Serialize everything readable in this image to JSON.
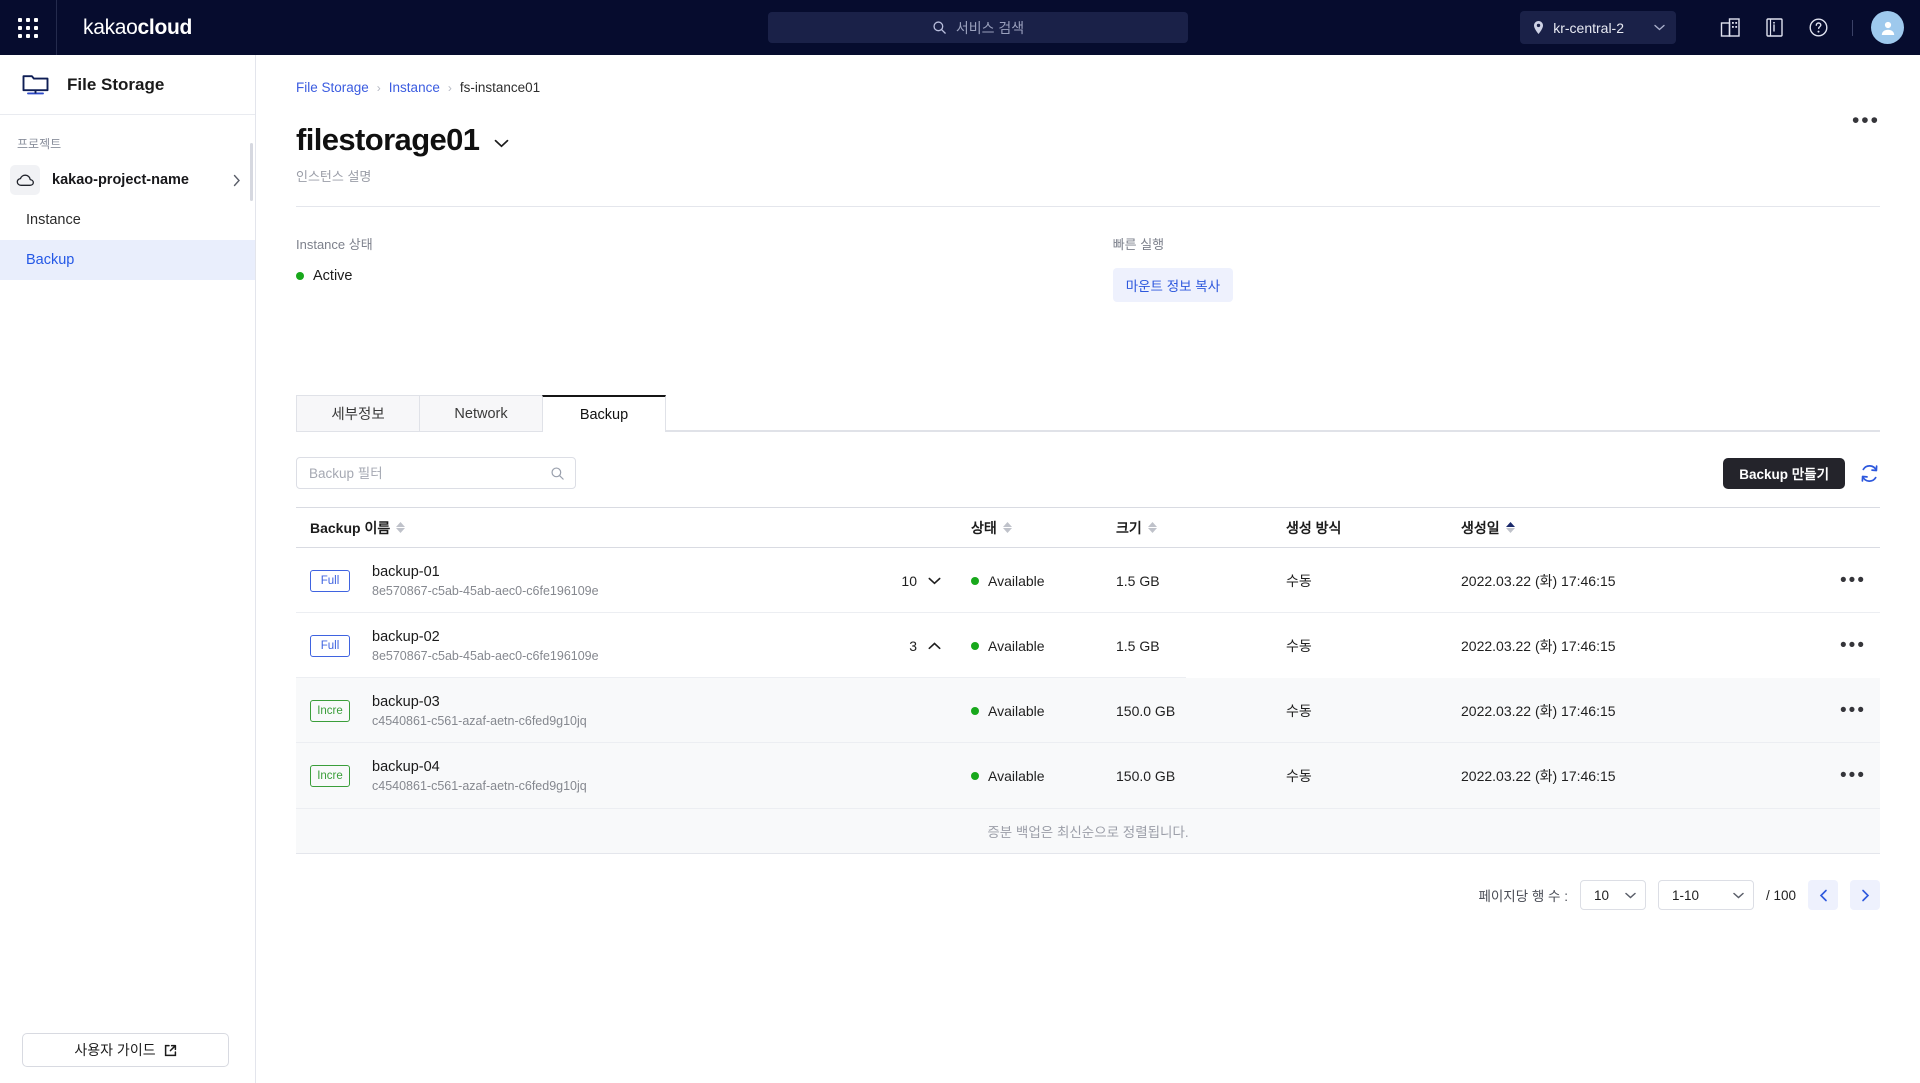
{
  "topbar": {
    "apps_icon": "apps-grid-icon",
    "brand_light": "kakao",
    "brand_bold": "cloud",
    "search_placeholder": "서비스 검색",
    "search_icon": "search-icon",
    "region": "kr-central-2",
    "region_icon": "location-pin-icon",
    "icons": [
      "organization-icon",
      "documentation-icon",
      "help-icon"
    ],
    "avatar_icon": "user-avatar-icon"
  },
  "sidebar": {
    "service_title": "File Storage",
    "service_icon": "monitor-icon",
    "section_label": "프로젝트",
    "project_name": "kakao-project-name",
    "project_icon": "cloud-icon",
    "items": [
      {
        "label": "Instance",
        "active": false
      },
      {
        "label": "Backup",
        "active": true
      }
    ],
    "guide_button": "사용자 가이드",
    "guide_icon": "external-link-icon"
  },
  "breadcrumb": [
    {
      "label": "File Storage",
      "link": true
    },
    {
      "label": "Instance",
      "link": true
    },
    {
      "label": "fs-instance01",
      "link": false
    }
  ],
  "page": {
    "title": "filestorage01",
    "title_chevron_icon": "chevron-down-icon",
    "kebab_icon": "more-options-icon",
    "description_placeholder": "인스턴스 설명"
  },
  "info": {
    "status_label": "Instance 상태",
    "status_value": "Active",
    "status_color": "#18a81b",
    "quick_label": "빠른 실행",
    "quick_action": "마운트 정보 복사"
  },
  "tabs": [
    {
      "label": "세부정보",
      "active": false
    },
    {
      "label": "Network",
      "active": false
    },
    {
      "label": "Backup",
      "active": true
    }
  ],
  "toolbar": {
    "filter_placeholder": "Backup 필터",
    "filter_value": "",
    "search_icon": "search-icon",
    "create_button": "Backup 만들기",
    "refresh_icon": "refresh-icon"
  },
  "table": {
    "columns": [
      {
        "label": "Backup 이름",
        "sortable": true,
        "sorted": false
      },
      {
        "label": "상태",
        "sortable": true,
        "sorted": false
      },
      {
        "label": "크기",
        "sortable": true,
        "sorted": false
      },
      {
        "label": "생성 방식",
        "sortable": false,
        "sorted": false
      },
      {
        "label": "생성일",
        "sortable": true,
        "sorted": "asc"
      }
    ],
    "rows": [
      {
        "badge": "Full",
        "badge_type": "full",
        "name": "backup-01",
        "uuid": "8e570867-c5ab-45ab-aec0-c6fe196109e",
        "count": "10",
        "expanded": false,
        "status": "Available",
        "size": "1.5 GB",
        "method": "수동",
        "created": "2022.03.22 (화) 17:46:15",
        "sub": false
      },
      {
        "badge": "Full",
        "badge_type": "full",
        "name": "backup-02",
        "uuid": "8e570867-c5ab-45ab-aec0-c6fe196109e",
        "count": "3",
        "expanded": true,
        "status": "Available",
        "size": "1.5 GB",
        "method": "수동",
        "created": "2022.03.22 (화) 17:46:15",
        "sub": false
      },
      {
        "badge": "Incre",
        "badge_type": "incre",
        "name": "backup-03",
        "uuid": "c4540861-c561-azaf-aetn-c6fed9g10jq",
        "count": "",
        "expanded": null,
        "status": "Available",
        "size": "150.0 GB",
        "method": "수동",
        "created": "2022.03.22 (화) 17:46:15",
        "sub": true
      },
      {
        "badge": "Incre",
        "badge_type": "incre",
        "name": "backup-04",
        "uuid": "c4540861-c561-azaf-aetn-c6fed9g10jq",
        "count": "",
        "expanded": null,
        "status": "Available",
        "size": "150.0 GB",
        "method": "수동",
        "created": "2022.03.22 (화) 17:46:15",
        "sub": true
      }
    ],
    "note": "증분 백업은 최신순으로 정렬됩니다.",
    "row_kebab_icon": "more-options-icon"
  },
  "pagination": {
    "rows_label": "페이지당 행 수 :",
    "rows_value": "10",
    "range_value": "1-10",
    "total": "/ 100",
    "prev_icon": "chevron-left-icon",
    "next_icon": "chevron-right-icon"
  }
}
